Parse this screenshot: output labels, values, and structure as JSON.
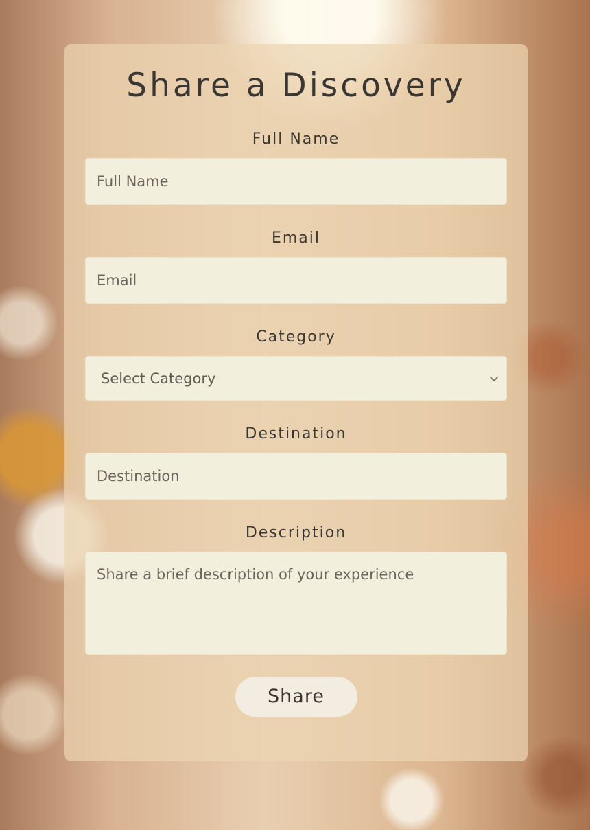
{
  "form": {
    "title": "Share a Discovery",
    "fields": {
      "full_name": {
        "label": "Full Name",
        "placeholder": "Full Name"
      },
      "email": {
        "label": "Email",
        "placeholder": "Email"
      },
      "category": {
        "label": "Category",
        "selected": "Select Category",
        "icon": "chevron-down-icon"
      },
      "destination": {
        "label": "Destination",
        "placeholder": "Destination"
      },
      "description": {
        "label": "Description",
        "placeholder": "Share a brief description of your experience"
      }
    },
    "submit_label": "Share"
  },
  "colors": {
    "card_background": "#ecd4b2",
    "input_background": "#f2efdd",
    "button_background": "#f2ede0",
    "text": "#3a3733"
  }
}
